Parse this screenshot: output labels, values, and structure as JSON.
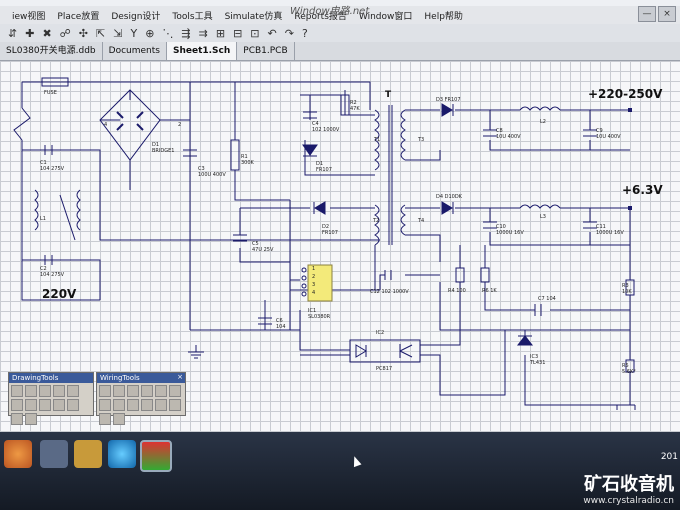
{
  "menu": {
    "items": [
      "iew视图",
      "Place放置",
      "Design设计",
      "Tools工具",
      "Simulate仿真",
      "Reports报告",
      "Window窗口",
      "Help帮助"
    ],
    "window_buttons": [
      "—",
      "×"
    ]
  },
  "toolbar": {
    "icons": [
      "⇵",
      "✚",
      "✖",
      "☍",
      "✣",
      "⇱",
      "⇲",
      "Y",
      "⊕",
      "⋱",
      "⇶",
      "⇉",
      "⊞",
      "⊟",
      "⊡",
      "↶",
      "↷",
      "?"
    ]
  },
  "doc_tabs": [
    "SL0380开关电源.ddb",
    "Documents",
    "Sheet1.Sch",
    "PCB1.PCB"
  ],
  "title_overlay": "Window电路.net",
  "schematic": {
    "labels": {
      "fuse": "FUSE",
      "bridge": "D1\nBRIDGE1",
      "c1": "C1\n104 275V",
      "l1": "L1",
      "c2": "C2\n104 275V",
      "input_voltage": "220V",
      "node4": "4",
      "node2": "2",
      "c3": "C3\n100U 400V",
      "r1": "R1\n300K",
      "c4": "C4\n102 1000V",
      "r2": "R2\n47K",
      "d1": "D1\nFR107",
      "d2": "D2\nFR107",
      "c5": "C5\n47U 25V",
      "t": "T",
      "t1": "T1",
      "t2": "T2",
      "t3": "T3",
      "t4": "T4",
      "d3": "D3 FR107",
      "d4": "D4 D10DK",
      "l2": "L2",
      "l3": "L3",
      "c8": "C8\n10U 400V",
      "c9": "C9\n10U 400V",
      "c10": "C10\n1000U 16V",
      "c11": "C11\n1000U 16V",
      "out_hv": "+220-250V",
      "out_lv": "+6.3V",
      "ic1_pins": [
        "1",
        "2",
        "3",
        "4"
      ],
      "ic1": "IC1\nSL0380R",
      "c6": "C6\n104",
      "c12": "C12 102 1000V",
      "r4": "R4 100",
      "r6": "R6 1K",
      "c7": "C7 104",
      "r3": "R3\n10K",
      "r5": "R5\n5.6K*",
      "ic2": "IC2",
      "pc817": "PC817",
      "ic3": "IC3\nTL431"
    }
  },
  "panels": {
    "drawing": "DrawingTools",
    "wiring": "WiringTools"
  },
  "taskbar": {
    "watermark": "矿石收音机",
    "watermark_url": "www.crystalradio.cn",
    "clock": "201"
  }
}
